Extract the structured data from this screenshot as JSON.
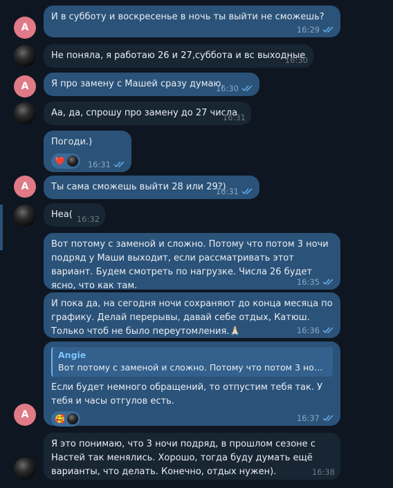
{
  "colors": {
    "background": "#0e1621",
    "outgoing_bubble": "#2b5278",
    "incoming_bubble": "#182533",
    "avatar_a": "#e07a86",
    "read_check": "#6ab3f3"
  },
  "avatar_letter": "A",
  "messages": [
    {
      "text": "И в субботу и воскресенье в ночь ты выйти не сможешь?",
      "time": "16:29"
    },
    {
      "text": "Не поняла, я работаю 26 и 27,суббота и вс выходные",
      "time": "16:30"
    },
    {
      "text": "Я про замену с Машей сразу думаю.",
      "time": "16:30"
    },
    {
      "text": "Аа, да, спрошу про замену до 27 числа",
      "time": "16:31"
    },
    {
      "text": "Погоди.)",
      "time": "16:31",
      "reaction_emoji": "❤️"
    },
    {
      "text": "Ты сама сможешь выйти 28 или 29?)",
      "time": "16:31"
    },
    {
      "text": "Неа(",
      "time": "16:32"
    },
    {
      "text": "Вот потому с заменой и сложно. Потому что потом 3 ночи подряд у Маши выходит, если рассматривать этот вариант. Будем смотреть по нагрузке. Числа 26 будет ясно, что как там.",
      "time": "16:35"
    },
    {
      "text": "И пока да, на сегодня ночи сохраняют до конца месяца по графику. Делай перерывы, давай себе отдых, Катюш. Только чтоб не было переутомления.🙏🏻",
      "time": "16:36"
    },
    {
      "reply_name": "Angie",
      "reply_text": "Вот потому с заменой и сложно. Потому что потом 3 ночи п...",
      "text": "Если будет немного обращений, то отпустим тебя так. У тебя и часы отгулов есть.",
      "time": "16:37",
      "reaction_emoji": "🥰"
    },
    {
      "text": "Я это понимаю, что 3 ночи подряд, в прошлом сезоне с Настей так менялись. Хорошо, тогда буду думать ещё варианты, что делать. Конечно, отдых нужен).",
      "time": "16:38"
    }
  ]
}
